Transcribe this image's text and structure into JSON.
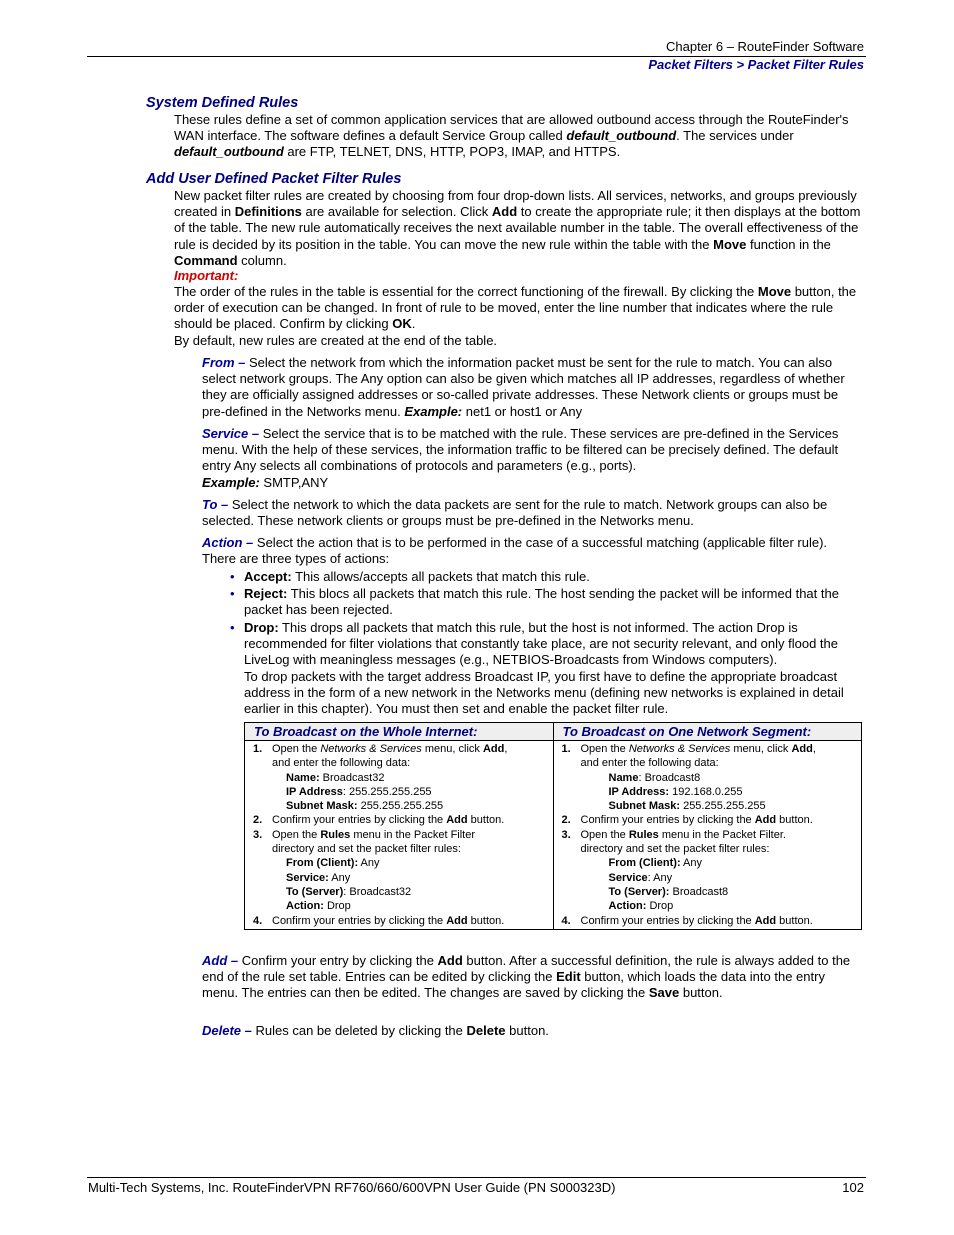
{
  "header": {
    "chapter": "Chapter 6 – RouteFinder Software",
    "section": "Packet Filters > Packet Filter Rules"
  },
  "system_rules": {
    "heading": "System Defined Rules",
    "text_1": "These rules define a set of common application services that are allowed outbound access through the RouteFinder's WAN interface. The software defines a default Service Group called ",
    "group_name": "default_outbound",
    "text_2": ". The services under ",
    "group_name_2": "default_outbound",
    "text_3": "  are FTP, TELNET, DNS, HTTP, POP3, IMAP, and HTTPS."
  },
  "user_rules": {
    "heading": "Add User Defined Packet Filter Rules",
    "p1_a": "New packet filter rules are created by choosing from four drop-down lists. All services, networks, and groups previously created in ",
    "p1_b": "Definitions",
    "p1_c": " are available for selection. Click ",
    "p1_d": "Add",
    "p1_e": " to create the appropriate rule; it then displays at the bottom of the table. The new rule automatically receives the next available number in the table. The overall effectiveness of the rule is decided by its position in the table. You can move the new rule within the table with the ",
    "p1_f": "Move",
    "p1_g": " function in the ",
    "p1_h": "Command",
    "p1_i": " column.",
    "important_label": "Important:",
    "p2_a": "The order of the rules in the table is essential for the correct functioning of the firewall. By clicking the ",
    "p2_b": "Move",
    "p2_c": " button, the order of execution can be changed. In front of rule to be moved, enter the line number that indicates where the rule should be placed. Confirm by clicking ",
    "p2_d": "OK",
    "p2_e": ".",
    "p3": "By default, new rules are created at the end of the table."
  },
  "fields": {
    "from": {
      "term": "From –",
      "text": " Select the network from which the information packet must be sent for the rule to match.  You can also select network groups. The Any option can also be given which matches all IP addresses, regardless of whether they are officially assigned addresses or so-called private addresses. These Network clients or groups must be pre-defined in the Networks menu. ",
      "example_label": "Example:",
      "example": " net1 or host1 or Any"
    },
    "service": {
      "term": "Service –",
      "text": " Select the service that is to be matched with the rule. These services are pre-defined in the Services menu. With the help of these services, the information traffic to be filtered can be precisely defined. The default entry Any selects all combinations of protocols and parameters (e.g., ports).",
      "example_label": "Example:",
      "example": " SMTP,ANY"
    },
    "to": {
      "term": "To –",
      "text": " Select the network to which the data packets are sent for the rule to match. Network groups can also be selected. These network clients or groups must be pre-defined in the Networks menu."
    },
    "action": {
      "term": "Action –",
      "text": " Select the action that is to be performed in the case of a successful matching (applicable filter rule).  There are three types of actions:",
      "bullets": [
        {
          "label": "Accept:",
          "text": " This allows/accepts all packets that match this rule."
        },
        {
          "label": "Reject:",
          "text": " This blocs all packets that match this rule. The host sending the packet will be informed that the packet has been rejected."
        },
        {
          "label": "Drop:",
          "text": " This drops all packets that match this rule, but the host is not informed. The action Drop is recommended for filter violations that constantly take place, are not security relevant, and only flood the LiveLog with meaningless messages (e.g., NETBIOS-Broadcasts from Windows computers)."
        }
      ],
      "drop_note": "To drop packets with the target address Broadcast IP, you first have to define the appropriate broadcast address in the form of a new network in the Networks menu (defining new networks is explained in detail earlier in this chapter).  You must then set and enable the packet filter rule."
    },
    "add": {
      "term": "Add –",
      "text_a": " Confirm your entry by clicking the ",
      "b1": "Add",
      "text_b": " button.  After a successful definition, the rule is always added to the end of the rule set table. Entries can be edited by clicking the ",
      "b2": "Edit",
      "text_c": " button, which loads the data into the entry menu. The entries can then be edited. The changes are saved by clicking the ",
      "b3": "Save",
      "text_d": " button."
    },
    "delete": {
      "term": "Delete –",
      "text_a": " Rules can be deleted by clicking the ",
      "b1": "Delete",
      "text_b": " button."
    }
  },
  "broadcast_table": {
    "columns": [
      {
        "header": "To Broadcast on the Whole Internet:",
        "s1_num": "1.",
        "s1_a": "Open the ",
        "s1_menu": "Networks & Services",
        "s1_b": " menu, click ",
        "s1_add": "Add",
        "s1_c": ",",
        "s1_d": "and enter the following data:",
        "name_label": "Name:",
        "name_value": " Broadcast32",
        "ip_label": "IP Address",
        "ip_value": ": 255.255.255.255",
        "mask_label": "Subnet Mask:",
        "mask_value": " 255.255.255.255",
        "s2_num": "2.",
        "s2_a": "Confirm your entries by clicking the ",
        "s2_add": "Add",
        "s2_b": " button.",
        "s3_num": "3.",
        "s3_a": "Open the ",
        "s3_rules": "Rules",
        "s3_b": " menu in the Packet Filter",
        "s3_c": "directory and set the packet filter rules:",
        "from_label": "From (Client):",
        "from_value": " Any",
        "service_label": "Service:",
        "service_value": " Any",
        "to_label": "To (Server)",
        "to_value": ": Broadcast32",
        "action_label": "Action:",
        "action_value": " Drop",
        "s4_num": "4.",
        "s4_a": "Confirm your entries by clicking the ",
        "s4_add": "Add",
        "s4_b": " button."
      },
      {
        "header": "To Broadcast on One Network Segment:",
        "s1_num": "1.",
        "s1_a": "Open the ",
        "s1_menu": "Networks & Services",
        "s1_b": " menu, click ",
        "s1_add": "Add",
        "s1_c": ",",
        "s1_d": "and enter the following data:",
        "name_label": "Name",
        "name_value": ": Broadcast8",
        "ip_label": "IP Address:",
        "ip_value": " 192.168.0.255",
        "mask_label": "Subnet Mask:",
        "mask_value": " 255.255.255.255",
        "s2_num": "2.",
        "s2_a": "Confirm your entries by clicking the ",
        "s2_add": "Add",
        "s2_b": " button.",
        "s3_num": "3.",
        "s3_a": "Open the ",
        "s3_rules": "Rules",
        "s3_b": " menu in the Packet Filter.",
        "s3_c": "directory and set the packet filter rules:",
        "from_label": "From (Client):",
        "from_value": " Any",
        "service_label": "Service",
        "service_value": ": Any",
        "to_label": "To (Server):",
        "to_value": " Broadcast8",
        "action_label": "Action:",
        "action_value": " Drop",
        "s4_num": "4.",
        "s4_a": "Confirm your entries by clicking the ",
        "s4_add": "Add",
        "s4_b": " button."
      }
    ]
  },
  "footer": {
    "text": "Multi-Tech Systems, Inc. RouteFinderVPN RF760/660/600VPN User Guide (PN S000323D)",
    "page": "102"
  }
}
